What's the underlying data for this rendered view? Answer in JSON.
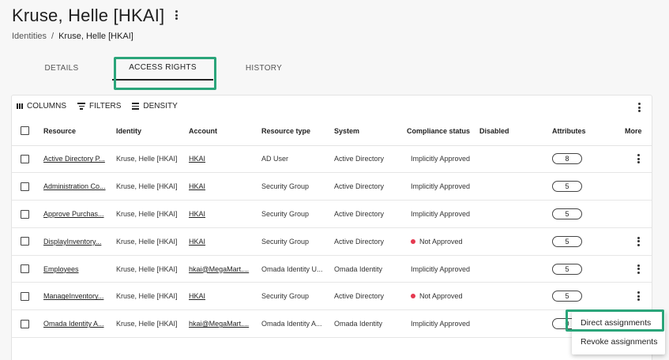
{
  "page": {
    "title": "Kruse, Helle [HKAI]"
  },
  "breadcrumb": {
    "root": "Identities",
    "separator": "/",
    "current": "Kruse, Helle [HKAI]"
  },
  "tabs": [
    {
      "label": "DETAILS",
      "active": false
    },
    {
      "label": "ACCESS RIGHTS",
      "active": true
    },
    {
      "label": "HISTORY",
      "active": false
    }
  ],
  "toolbar": {
    "columns_label": "COLUMNS",
    "filters_label": "FILTERS",
    "density_label": "DENSITY"
  },
  "table": {
    "headers": {
      "resource": "Resource",
      "identity": "Identity",
      "account": "Account",
      "resource_type": "Resource type",
      "system": "System",
      "compliance": "Compliance status",
      "disabled": "Disabled",
      "attributes": "Attributes",
      "more": "More"
    },
    "rows": [
      {
        "resource": "Active Directory P...",
        "identity": "Kruse, Helle [HKAI]",
        "account": "HKAI",
        "resource_type": "AD User",
        "system": "Active Directory",
        "compliance": "Implicitly Approved",
        "approved": true,
        "disabled": "",
        "attributes": "8",
        "more": true
      },
      {
        "resource": "Administration Co...",
        "identity": "Kruse, Helle [HKAI]",
        "account": "HKAI",
        "resource_type": "Security Group",
        "system": "Active Directory",
        "compliance": "Implicitly Approved",
        "approved": true,
        "disabled": "",
        "attributes": "5",
        "more": false
      },
      {
        "resource": "Approve Purchas...",
        "identity": "Kruse, Helle [HKAI]",
        "account": "HKAI",
        "resource_type": "Security Group",
        "system": "Active Directory",
        "compliance": "Implicitly Approved",
        "approved": true,
        "disabled": "",
        "attributes": "5",
        "more": false
      },
      {
        "resource": "DisplayInventory...",
        "identity": "Kruse, Helle [HKAI]",
        "account": "HKAI",
        "resource_type": "Security Group",
        "system": "Active Directory",
        "compliance": "Not Approved",
        "approved": false,
        "disabled": "",
        "attributes": "5",
        "more": true
      },
      {
        "resource": "Employees",
        "identity": "Kruse, Helle [HKAI]",
        "account": "hkai@MegaMart....",
        "resource_type": "Omada Identity U...",
        "system": "Omada Identity",
        "compliance": "Implicitly Approved",
        "approved": true,
        "disabled": "",
        "attributes": "5",
        "more": true
      },
      {
        "resource": "ManageInventory...",
        "identity": "Kruse, Helle [HKAI]",
        "account": "HKAI",
        "resource_type": "Security Group",
        "system": "Active Directory",
        "compliance": "Not Approved",
        "approved": false,
        "disabled": "",
        "attributes": "5",
        "more": true
      },
      {
        "resource": "Omada Identity A...",
        "identity": "Kruse, Helle [HKAI]",
        "account": "hkai@MegaMart....",
        "resource_type": "Omada Identity A...",
        "system": "Omada Identity",
        "compliance": "Implicitly Approved",
        "approved": true,
        "disabled": "",
        "attributes": "0",
        "more": false
      }
    ]
  },
  "context_menu": {
    "items": [
      "Direct assignments",
      "Revoke assignments"
    ]
  },
  "colors": {
    "highlight": "#2aa57a",
    "not_approved": "#e53950"
  }
}
